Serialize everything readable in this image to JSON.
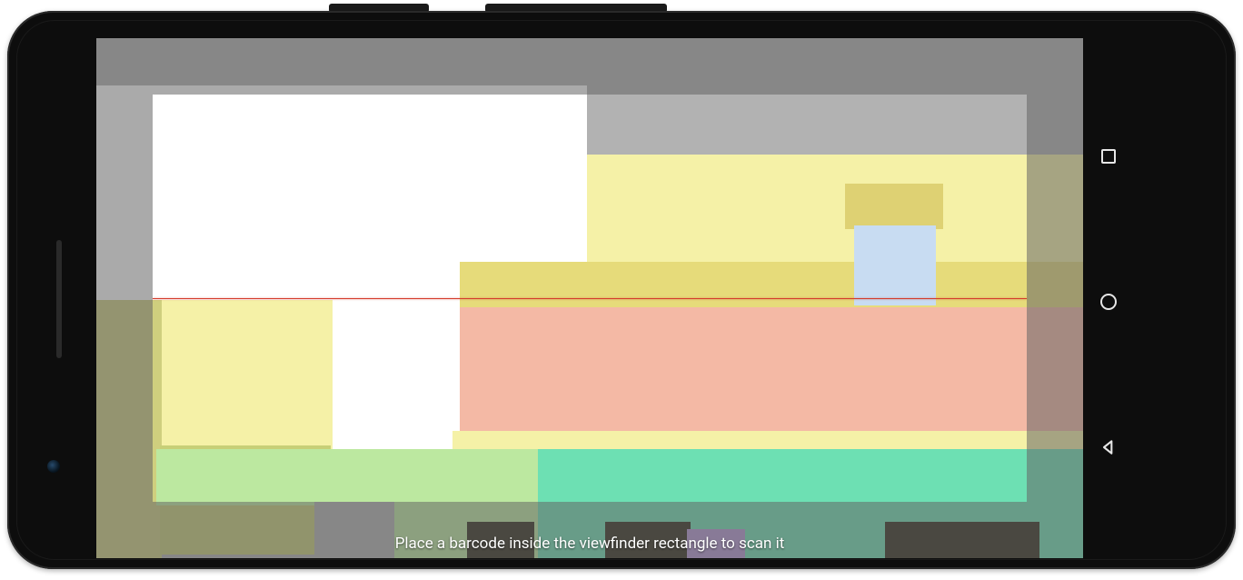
{
  "scanner": {
    "hint_text": "Place a barcode inside the viewfinder rectangle to scan it"
  },
  "nav": {
    "recent_label": "recent-apps",
    "home_label": "home",
    "back_label": "back"
  },
  "colors": {
    "laser": "#d43a2a",
    "overlay": "rgba(100,100,100,0.55)"
  }
}
